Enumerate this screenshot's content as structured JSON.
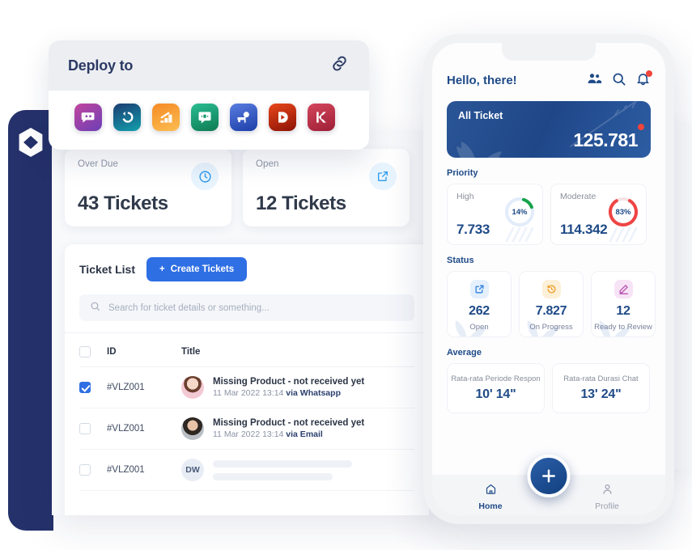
{
  "brand": {
    "logo_icon": "hexagon-logo",
    "navy": "#25316a",
    "blue": "#2f6fe4",
    "deep_blue": "#1e4a87",
    "red": "#f0453a",
    "green": "#16a34a"
  },
  "deploy": {
    "title": "Deploy to",
    "link_icon": "link-chain-icon",
    "apps": [
      {
        "name": "chatbot-app",
        "icon": "chat-robot-icon",
        "c1": "#c2459e",
        "c2": "#6b3fb5"
      },
      {
        "name": "redash-app",
        "icon": "circle-arrow-icon",
        "c1": "#1c3b72",
        "c2": "#12a0ad"
      },
      {
        "name": "analytics-app",
        "icon": "stairs-arrow-icon",
        "c1": "#f58a26",
        "c2": "#fbbe52"
      },
      {
        "name": "livechat-app",
        "icon": "speech-bubble-icon",
        "c1": "#2bbd92",
        "c2": "#0d7a52"
      },
      {
        "name": "telemarket-app",
        "icon": "megaphone-icon",
        "c1": "#5a7de0",
        "c2": "#1b3ea8"
      },
      {
        "name": "dialog-app",
        "icon": "d-letter-icon",
        "c1": "#e8471a",
        "c2": "#8c1206"
      },
      {
        "name": "kommo-app",
        "icon": "k-letter-icon",
        "c1": "#d4465c",
        "c2": "#9e1f36"
      }
    ]
  },
  "dashboard": {
    "stats": [
      {
        "label": "Over Due",
        "value": "43 Tickets",
        "icon": "clock-icon"
      },
      {
        "label": "Open",
        "value": "12 Tickets",
        "icon": "external-link-icon"
      }
    ],
    "list_title": "Ticket List",
    "create_label": "Create Tickets",
    "create_plus": "+",
    "search_placeholder": "Search for ticket details or something...",
    "search_value": "",
    "search_icon": "search-icon",
    "columns": [
      "ID",
      "Title"
    ],
    "rows": [
      {
        "checked": true,
        "id": "#VLZ001",
        "avatar": "av1",
        "initials": "",
        "title": "Missing Product - not received yet",
        "meta": "11 Mar 2022 13:14 ",
        "channel": "via Whatsapp",
        "skeleton": false
      },
      {
        "checked": false,
        "id": "#VLZ001",
        "avatar": "av2",
        "initials": "",
        "title": "Missing Product - not received yet",
        "meta": "11 Mar 2022 13:14 ",
        "channel": "via Email",
        "skeleton": false
      },
      {
        "checked": false,
        "id": "#VLZ001",
        "avatar": "avi",
        "initials": "DW",
        "title": "",
        "meta": "",
        "channel": "",
        "skeleton": true
      }
    ]
  },
  "phone": {
    "greeting": "Hello, there!",
    "header_icons": [
      {
        "name": "people-group-icon"
      },
      {
        "name": "search-icon"
      },
      {
        "name": "bell-notification-icon"
      }
    ],
    "all_ticket": {
      "label": "All Ticket",
      "value": "125.781",
      "badge": "dot"
    },
    "priority": {
      "heading": "Priority",
      "cards": [
        {
          "label": "High",
          "value": "7.733",
          "percent": "14%",
          "percent_num": 14,
          "color": "#16a34a"
        },
        {
          "label": "Moderate",
          "value": "114.342",
          "percent": "83%",
          "percent_num": 83,
          "color": "#ef4444"
        }
      ]
    },
    "status": {
      "heading": "Status",
      "cards": [
        {
          "label": "Open",
          "value": "262",
          "icon": "external-link-icon",
          "bg": "#e4f0fd",
          "fg": "#2f82e0"
        },
        {
          "label": "On Progress",
          "value": "7.827",
          "icon": "history-clock-icon",
          "bg": "#fdf0d8",
          "fg": "#f0a029"
        },
        {
          "label": "Ready to Review",
          "value": "12",
          "icon": "pencil-icon",
          "bg": "#f7e3f6",
          "fg": "#b855b0"
        }
      ]
    },
    "average": {
      "heading": "Average",
      "cards": [
        {
          "label": "Rata-rata Periode Respon",
          "value": "10' 14\""
        },
        {
          "label": "Rata-rata Durasi Chat",
          "value": "13' 24\""
        }
      ]
    },
    "tabs": [
      {
        "label": "Home",
        "icon": "home-icon",
        "active": true
      },
      {
        "label": "Profile",
        "icon": "person-icon",
        "active": false
      }
    ],
    "fab": {
      "icon": "plus-icon",
      "label": "+"
    }
  }
}
